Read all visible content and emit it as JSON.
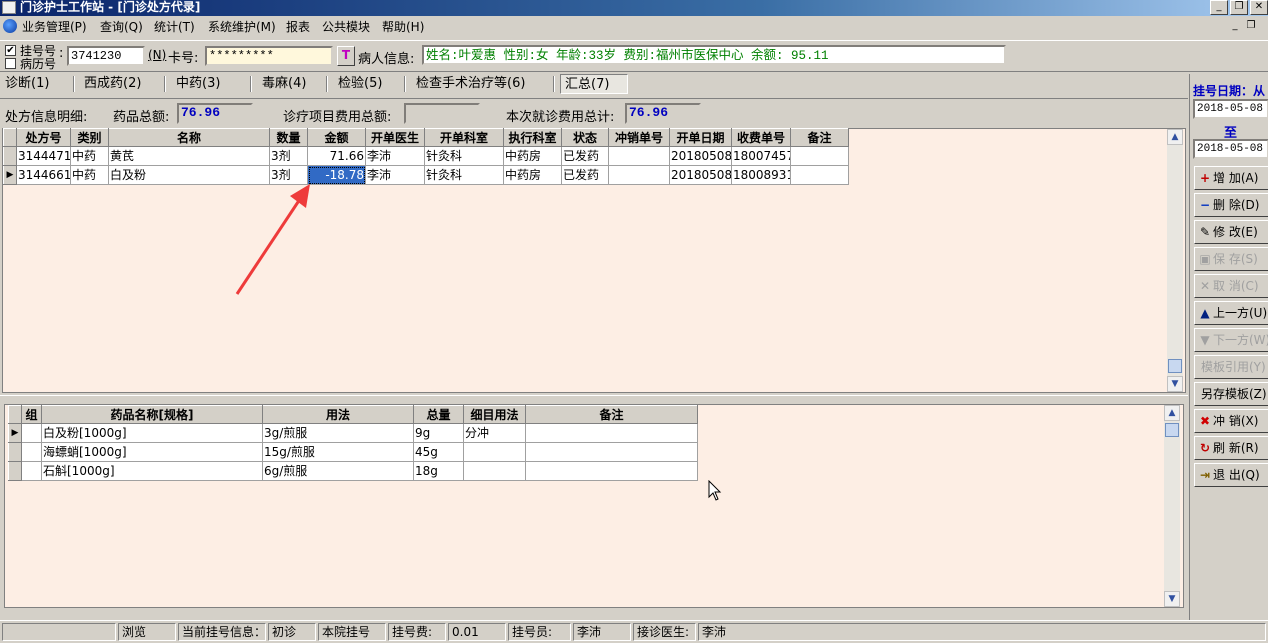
{
  "window": {
    "title": "门诊护士工作站 - [门诊处方代录]"
  },
  "menu": [
    "业务管理(P)",
    "查询(Q)",
    "统计(T)",
    "系统维护(M)",
    "报表",
    "公共模块",
    "帮助(H)"
  ],
  "toolbar": {
    "reg_no_label": "挂号号",
    "record_no_label": "病历号",
    "reg_no_checked": true,
    "reg_no_value": "3741230",
    "n_label": "(N)",
    "card_label": "卡号:",
    "card_value": "*********",
    "patient_info_label": "病人信息:",
    "patient_info_value": "姓名:叶爱惠 性别:女 年龄:33岁 费别:福州市医保中心 余额: 95.11"
  },
  "tabs": [
    "诊断(1)",
    "西成药(2)",
    "中药(3)",
    "毒麻(4)",
    "检验(5)",
    "检查手术治疗等(6)",
    "汇总(7)"
  ],
  "active_tab_index": 6,
  "summary": {
    "detail_label": "处方信息明细:",
    "drug_total_label": "药品总额:",
    "drug_total_value": "76.96",
    "treat_total_label": "诊疗项目费用总额:",
    "treat_total_value": "",
    "visit_total_label": "本次就诊费用总计:",
    "visit_total_value": "76.96"
  },
  "rx_table": {
    "columns": [
      "处方号",
      "类别",
      "名称",
      "数量",
      "金额",
      "开单医生",
      "开单科室",
      "执行科室",
      "状态",
      "冲销单号",
      "开单日期",
      "收费单号",
      "备注"
    ],
    "rows": [
      [
        "3144471",
        "中药",
        "黄芪",
        "3剂",
        "71.66",
        "李沛",
        "针灸科",
        "中药房",
        "已发药",
        "",
        "20180508",
        "18007457",
        ""
      ],
      [
        "3144661",
        "中药",
        "白及粉",
        "3剂",
        "-18.78",
        "李沛",
        "针灸科",
        "中药房",
        "已发药",
        "",
        "20180508",
        "18008931",
        ""
      ]
    ],
    "current_row": 1,
    "selected_cell": "-18.78"
  },
  "detail_table": {
    "columns": [
      "组",
      "药品名称[规格]",
      "用法",
      "总量",
      "细目用法",
      "备注"
    ],
    "rows": [
      [
        "",
        "白及粉[1000g]",
        "3g/煎服",
        "9g",
        "分冲",
        ""
      ],
      [
        "",
        "海螵蛸[1000g]",
        "15g/煎服",
        "45g",
        "",
        ""
      ],
      [
        "",
        "石斛[1000g]",
        "6g/煎服",
        "18g",
        "",
        ""
      ]
    ],
    "current_row": 0
  },
  "right_panel": {
    "reg_date_label": "挂号日期：从",
    "date_from": "2018-05-08",
    "to_label": "至",
    "date_to": "2018-05-08",
    "buttons": [
      {
        "label": "增 加(A)",
        "icon": "add-icon",
        "enabled": true
      },
      {
        "label": "删 除(D)",
        "icon": "delete-icon",
        "enabled": true
      },
      {
        "label": "修 改(E)",
        "icon": "edit-icon",
        "enabled": true
      },
      {
        "label": "保 存(S)",
        "icon": "save-icon",
        "enabled": false
      },
      {
        "label": "取 消(C)",
        "icon": "cancel-icon",
        "enabled": false
      },
      {
        "label": "上一方(U)",
        "icon": "prev-icon",
        "enabled": true
      },
      {
        "label": "下一方(W)",
        "icon": "next-icon",
        "enabled": false
      },
      {
        "label": "模板引用(Y)",
        "icon": "",
        "enabled": false
      },
      {
        "label": "另存模板(Z)",
        "icon": "",
        "enabled": true
      },
      {
        "label": "冲 销(X)",
        "icon": "writeoff-icon",
        "enabled": true
      },
      {
        "label": "刷 新(R)",
        "icon": "refresh-icon",
        "enabled": true
      },
      {
        "label": "退 出(Q)",
        "icon": "exit-icon",
        "enabled": true
      }
    ]
  },
  "status_bar": {
    "mode": "浏览",
    "reg_info_label": "当前挂号信息：",
    "visit_type": "初诊",
    "reg_source": "本院挂号",
    "fee_label": "挂号费:",
    "fee_value": "0.01",
    "registrar_label": "挂号员:",
    "registrar": "李沛",
    "doctor_label": "接诊医生:",
    "doctor": "李沛"
  },
  "colors": {
    "title_bar": "#0a246a",
    "grid_bg": "#fdeee4",
    "selection": "#316ac5",
    "value_blue": "#0000c0",
    "patient_info_green": "#008000",
    "annotation_arrow": "#ee3b3b"
  }
}
